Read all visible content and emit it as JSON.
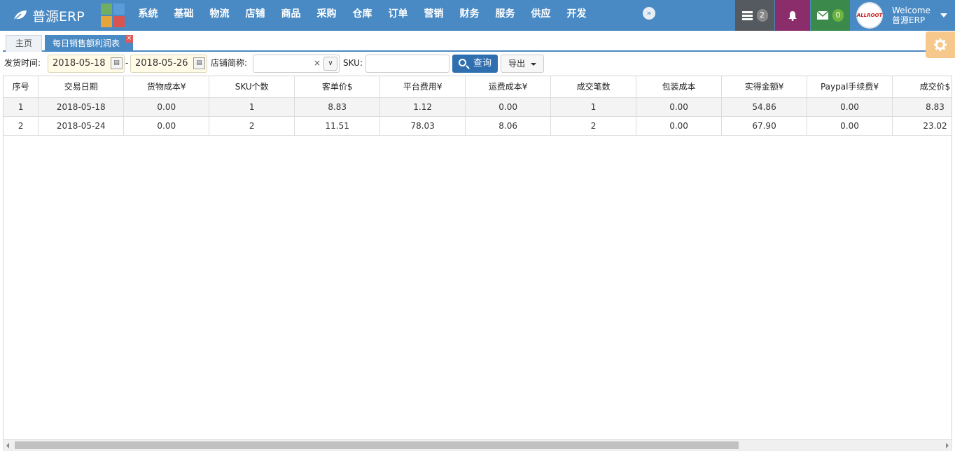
{
  "app": {
    "brand": "普源ERP",
    "menu": [
      "系统",
      "基础",
      "物流",
      "店铺",
      "商品",
      "采购",
      "仓库",
      "订单",
      "营销",
      "财务",
      "服务",
      "供应",
      "开发"
    ],
    "collapse_icon": "double-chevron-icon",
    "tasks_count": "2",
    "mail_count": "0",
    "user": {
      "welcome": "Welcome",
      "name": "普源ERP",
      "avatar_text": "ALLROOT"
    }
  },
  "tabs": {
    "home": "主页",
    "active": "每日销售额利润表",
    "close": "×"
  },
  "toolbar": {
    "ship_time_label": "发货时间:",
    "date_from": "2018-05-18",
    "date_sep": "-",
    "date_to": "2018-05-26",
    "shop_label": "店铺简称:",
    "shop_value": "",
    "clear": "×",
    "sku_label": "SKU:",
    "sku_value": "",
    "query_label": "查询",
    "export_label": "导出"
  },
  "grid": {
    "columns": [
      "序号",
      "交易日期",
      "货物成本¥",
      "SKU个数",
      "客单价$",
      "平台费用¥",
      "运费成本¥",
      "成交笔数",
      "包装成本",
      "实得金额¥",
      "Paypal手续费¥",
      "成交价$"
    ],
    "rows": [
      [
        "1",
        "2018-05-18",
        "0.00",
        "1",
        "8.83",
        "1.12",
        "0.00",
        "1",
        "0.00",
        "54.86",
        "0.00",
        "8.83"
      ],
      [
        "2",
        "2018-05-24",
        "0.00",
        "2",
        "11.51",
        "78.03",
        "8.06",
        "2",
        "0.00",
        "67.90",
        "0.00",
        "23.02"
      ]
    ]
  },
  "colors": {
    "navbar": "#4a8ac4",
    "query_button": "#2f6fb0",
    "bell_box": "#8b2d6a",
    "mail_box": "#3b8a4c",
    "tasks_box": "#555a60"
  }
}
